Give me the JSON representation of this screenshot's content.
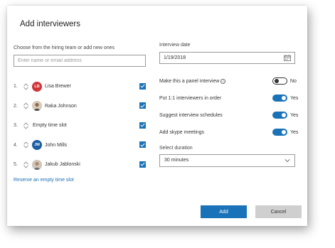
{
  "dialog": {
    "title": "Add interviewers"
  },
  "hiring_team": {
    "label": "Choose from the hiring team or add new ones",
    "input_placeholder": "Enter name or email address",
    "rows": [
      {
        "num": "1.",
        "name": "Lisa Brewer",
        "initials": "LB",
        "avatar": "initials",
        "checked": true
      },
      {
        "num": "2.",
        "name": "Raka Johnson",
        "initials": "",
        "avatar": "photo",
        "checked": true
      },
      {
        "num": "3.",
        "name": "Empty time slot",
        "initials": "",
        "avatar": "none",
        "checked": true
      },
      {
        "num": "4.",
        "name": "John Mills",
        "initials": "JM",
        "avatar": "initials",
        "checked": true
      },
      {
        "num": "5.",
        "name": "Jakub Jablonski",
        "initials": "",
        "avatar": "photo",
        "checked": true
      }
    ],
    "reserve_link": "Reserve an empty time slot"
  },
  "interview": {
    "date_label": "Interview date",
    "date_value": "1/19/2018",
    "options": [
      {
        "label": "Make this a panel interview",
        "info": "i",
        "state": "No",
        "on": false
      },
      {
        "label": "Put 1:1 interviewers in order",
        "state": "Yes",
        "on": true
      },
      {
        "label": "Suggest interview schedules",
        "state": "Yes",
        "on": true
      },
      {
        "label": "Add skype meetings",
        "state": "Yes",
        "on": true
      }
    ],
    "duration_label": "Select duration",
    "duration_value": "30 minutes"
  },
  "buttons": {
    "add": "Add",
    "cancel": "Cancel"
  },
  "colors": {
    "accent": "#1a73b8",
    "avatar_lb": "#d13438",
    "avatar_jm": "#1b5ea3",
    "cancel_bg": "#cfcfcf"
  },
  "icons": {
    "up": "chevron-up-icon",
    "down": "chevron-down-icon",
    "checkbox": "checkmark-icon",
    "calendar": "calendar-icon",
    "info": "info-icon",
    "dropdown": "chevron-down-icon"
  }
}
